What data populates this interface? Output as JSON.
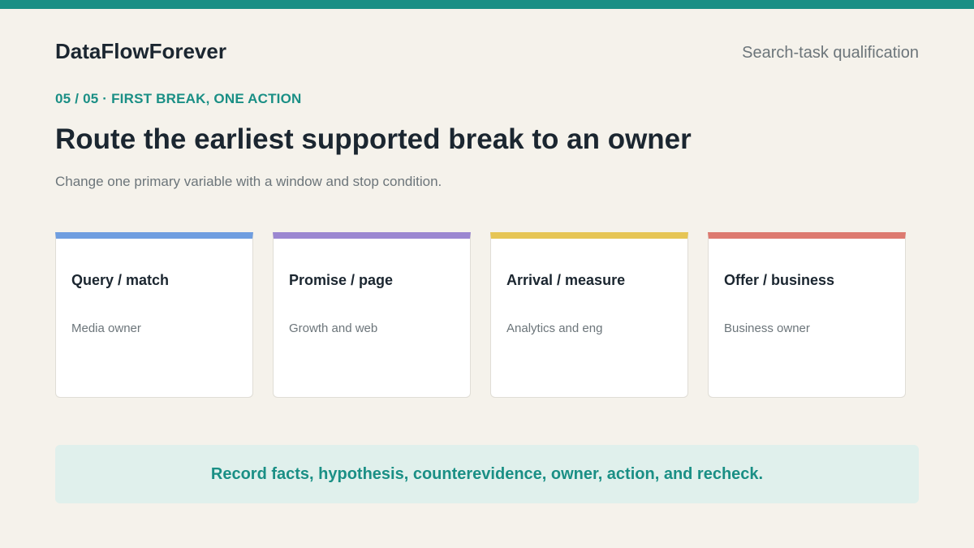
{
  "header": {
    "brand": "DataFlowForever",
    "context": "Search-task qualification"
  },
  "slide": {
    "kicker": "05 / 05 · FIRST BREAK, ONE ACTION",
    "title": "Route the earliest supported break to an owner",
    "subtitle": "Change one primary variable with a window and stop condition."
  },
  "cards": [
    {
      "title": "Query / match",
      "owner": "Media owner",
      "accent": "#6f9ee0"
    },
    {
      "title": "Promise / page",
      "owner": "Growth and web",
      "accent": "#9b87d1"
    },
    {
      "title": "Arrival / measure",
      "owner": "Analytics and eng",
      "accent": "#e6c555"
    },
    {
      "title": "Offer / business",
      "owner": "Business owner",
      "accent": "#dd7a70"
    }
  ],
  "callout": {
    "text": "Record facts, hypothesis, counterevidence, owner, action, and recheck."
  },
  "colors": {
    "accent": "#1a8f85",
    "background": "#f5f2eb",
    "callout_bg": "#e0f0ec"
  }
}
